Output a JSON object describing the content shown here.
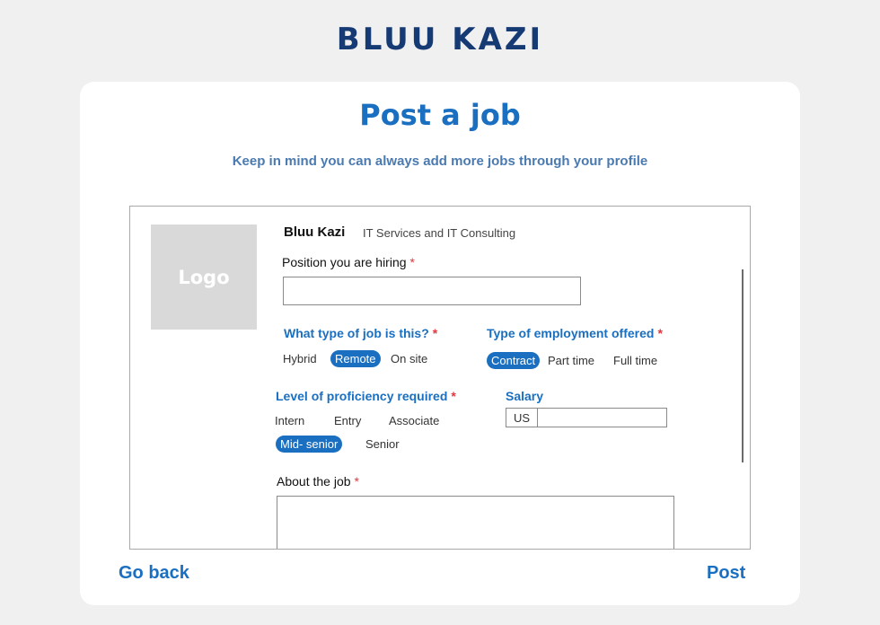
{
  "brand": {
    "name": "BLUU KAZI"
  },
  "page": {
    "title": "Post a job",
    "subtitle": "Keep in mind you can always add more jobs through your profile"
  },
  "company": {
    "logo_text": "Logo",
    "name": "Bluu Kazi",
    "industry": "IT Services and IT Consulting"
  },
  "form": {
    "position": {
      "label": "Position you are hiring",
      "required": "*",
      "value": "",
      "placeholder": ""
    },
    "job_type": {
      "label": "What type of job is this?",
      "required": "*",
      "options": [
        "Hybrid",
        "Remote",
        "On site"
      ],
      "selected": "Remote"
    },
    "employment_type": {
      "label": "Type of employment offered",
      "required": "*",
      "options": [
        "Contract",
        "Part time",
        "Full time"
      ],
      "selected": "Contract"
    },
    "proficiency": {
      "label": "Level of proficiency required",
      "required": "*",
      "options": [
        "Intern",
        "Entry",
        "Associate",
        "Mid- senior",
        "Senior"
      ],
      "selected": "Mid- senior"
    },
    "salary": {
      "label": "Salary",
      "currency": "US",
      "value": ""
    },
    "about": {
      "label": "About the job",
      "required": "*",
      "value": ""
    }
  },
  "actions": {
    "go_back": "Go back",
    "post": "Post"
  },
  "colors": {
    "brand": "#163a73",
    "accent": "#1a6fc0",
    "subtitle": "#4a7ab0",
    "required": "#e0383e"
  }
}
